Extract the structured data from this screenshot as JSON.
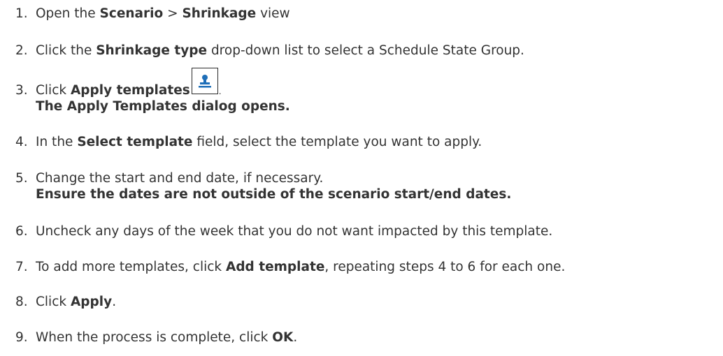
{
  "steps": [
    {
      "number": "1.",
      "parts": [
        "Open the ",
        "Scenario",
        " > ",
        "Shrinkage",
        " view"
      ]
    },
    {
      "number": "2.",
      "parts": [
        "Click the ",
        "Shrinkage type",
        " drop-down list to select a Schedule State Group."
      ]
    },
    {
      "number": "3.",
      "parts": [
        "Click ",
        "Apply templates",
        " "
      ],
      "end": ".",
      "icon": "apply-templates-stamp-icon",
      "note": "The Apply Templates dialog opens."
    },
    {
      "number": "4.",
      "parts": [
        "In the ",
        "Select template",
        " field, select the template you want to apply."
      ]
    },
    {
      "number": "5.",
      "parts": [
        "Change the start and end date, if necessary."
      ],
      "note": "Ensure the dates are not outside of the scenario start/end dates."
    },
    {
      "number": "6.",
      "parts": [
        "Uncheck any days of the week that you do not want impacted by this template."
      ]
    },
    {
      "number": "7.",
      "parts": [
        "To add more templates, click ",
        "Add template",
        ", repeating steps 4 to 6 for each one."
      ]
    },
    {
      "number": "8.",
      "parts": [
        "Click ",
        "Apply",
        "."
      ]
    },
    {
      "number": "9.",
      "parts": [
        "When the process is complete, click ",
        "OK",
        "."
      ]
    }
  ],
  "colors": {
    "text": "#333333",
    "icon_blue": "#1f6fb8",
    "icon_border": "#2a2a2a"
  }
}
